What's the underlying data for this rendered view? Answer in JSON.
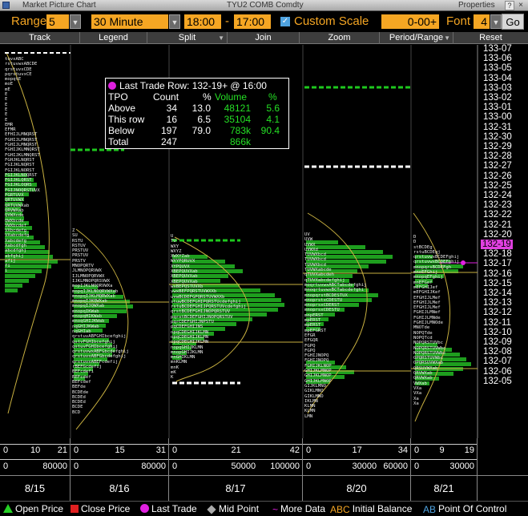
{
  "window": {
    "title": "Market Picture Chart",
    "security": "TYU2 COMB Comdty",
    "properties_label": "Properties",
    "help_label": "?",
    "close_label": "×"
  },
  "controls": {
    "range_label": "Range",
    "range_value": "5",
    "interval_value": "30 Minute",
    "start_time": "18:00",
    "dash": "-",
    "end_time": "17:00",
    "custom_scale_label": "Custom Scale",
    "custom_scale_checked": true,
    "scale_value": "0-00+",
    "font_label": "Font",
    "font_value": "4",
    "go_label": "Go"
  },
  "toolbar": [
    "Track",
    "Legend",
    "Split",
    "Join",
    "Zoom",
    "Period/Range",
    "Reset"
  ],
  "price_axis": [
    "133-07",
    "133-06",
    "133-05",
    "133-04",
    "133-03",
    "133-02",
    "133-01",
    "133-00",
    "132-31",
    "132-30",
    "132-29",
    "132-28",
    "132-27",
    "132-26",
    "132-25",
    "132-24",
    "132-23",
    "132-22",
    "132-21",
    "132-20",
    "132-19",
    "132-18",
    "132-17",
    "132-16",
    "132-15",
    "132-14",
    "132-13",
    "132-12",
    "132-11",
    "132-10",
    "132-09",
    "132-08",
    "132-07",
    "132-06",
    "132-05"
  ],
  "last_trade_price_index": 20,
  "info_box": {
    "header": "Last Trade Row:  132-19+ @  16:00",
    "columns": [
      "TPO",
      "Count",
      "%",
      "Volume",
      "%"
    ],
    "rows": [
      {
        "label": "Above",
        "count": "34",
        "pct": "13.0",
        "volume": "48121",
        "vpct": "5.6"
      },
      {
        "label": "This row",
        "count": "16",
        "pct": "6.5",
        "volume": "35104",
        "vpct": "4.1"
      },
      {
        "label": "Below",
        "count": "197",
        "pct": "79.0",
        "volume": "783k",
        "vpct": "90.4"
      },
      {
        "label": "Total",
        "count": "247",
        "pct": "",
        "volume": "866k",
        "vpct": ""
      }
    ]
  },
  "sessions": [
    {
      "date": "8/15",
      "tpo_scale": [
        "0",
        "10",
        "21"
      ],
      "vol_scale": [
        "0",
        "80000"
      ]
    },
    {
      "date": "8/16",
      "tpo_scale": [
        "0",
        "15",
        "31"
      ],
      "vol_scale": [
        "0",
        "80000"
      ]
    },
    {
      "date": "8/17",
      "tpo_scale": [
        "0",
        "21",
        "42"
      ],
      "vol_scale": [
        "0",
        "50000",
        "100000"
      ]
    },
    {
      "date": "8/20",
      "tpo_scale": [
        "0",
        "17",
        "34"
      ],
      "vol_scale": [
        "0",
        "30000",
        "60000"
      ]
    },
    {
      "date": "8/21",
      "tpo_scale": [
        "0",
        "9",
        "19"
      ],
      "vol_scale": [
        "0",
        "30000"
      ]
    }
  ],
  "tpo_letters": {
    "s1": "tuvxABC\nrstuvwxABCDE\nqrstuvxCDE\npqrstuvxCE\nmopqtE\nmoE\nmE\nE\nE\nE\nE\nE\nE\nEMR\nEFMR\nEFHIJLMNQRST\nFGHIJLMNQRST\nFGHIJLMNQRST\nFGHIJKLMNQRST\nFGHIJKLMNQRST\nFGHJKLNQRST\nFGIJKLNQRST\nFGIJKLNORST\nFGIJKLNOQRST\nFGIJKLQRST\nFGIJKLOQRS\nFGIJNOQRSTUVX\nFGRTUVX\nQRTUVWX\nQRTUVWXab\nQRVWXab\nQVWXcde\nQWXbcde\nVWXbcdef\nVXbcdefg\nVXabcdefg\nXabcdefg\nXabcdfgh\nabcdfghj\nabfghij\nafij\nfi\ni",
    "s2": "Z\nSU\nRSTU\nRSTUV\nPRSTUV\nPRSTUV\nPRSTV\nMNOPQRTV\nJLMNOPQRVWX\nIJLMNOPQRVWX\nIJKLMNOPQRSVWX\nmopIJKLNOQRVWXa\nmopqIJKLNOQRVWXab\nmnopqIJKLMQRWXab\nmnopqIJKQWXab\nmnopqIJQWXab\nmnopqIKWab\nmnopqHIKWab\nmnoqGHIJKWab\nnqGHIJKWab\nnqGHIab\nqrstuvABFGHIbcefghij\nqstvFGHIbcefghij\nqstuvFGHIbcefghij\nqrstuvwxABFGbcdefghij\nqrstuvxABFGbcdefghij\nqrstuvxABEFcdefij\nrBEFGcdefij\nBEFcdefi\nBEFcdef\nBEFcdef\nBEFde\nBCDEde\nBCDEd\nBCDEd\nBCDE\nBCD",
    "s3": "U\nTU\nWXY\nWXYZ\nXWXYZab\nWXYPQRUVX\nXYPQUVX\nXBEPQUVXab\nXBEPQUVXab\nXBEPQUVXab\nwxBEPQSTUVXb\nvwxBEFPQRSTUVWXXb\nuvwBCDEFGPQRSTUVWXXb\nstuwBCDEFGHIPQRSTUcdefghij\nrstuBCDEFGHIJPQRSTUVcdefghij\nqrstBCDEFGHIJNOPQRSTUV\npqrstBCDEFGHIJNOPQRSTUV\npqrCDEFGHIJNPSTU\npqCDEFGHIJNS\nopqCDEGHIJKLMN\nopqCDEGHIJKLMN\nopqCDEGHIJKLMN\nnopqGHIJKLMN\nmnopGHIJKLMN\nmnGHIKLMN\nmnKLMN\nmnK\nmK\nK",
    "s4": "UV\nUVW\nUVWX\nUVWXd\nTUVWXbcd\nTUVWXbcd\nTUVWXbcd\nTUVWXabcde\nqTUVXabcdeh\nqTUVXabcdefghij\nmoqrtuvwxABCTabcdefghij\nmnoqrtuvwxBCTabcdefghi\nmnopqrstBCDESTUX\nmnoprstxCDESTU\nmnoprsxCDERST\nmnoprsxCDESTU\nmnpERST\nmpERST\nmpERST\nmpEFGRST\nEFGR\nEFGQR\nFGPQ\nFGPQ\nFGHIJNOPQ\nFGHIJNOPQ\nFGHIJKLNOP\nGHIJKLMNOP\nGHIJKLMNOP\nGHIJKLMNOP\nGIJKLMNO\nGIKLMNO\nGIKLMNO\nIKLMN\nKLMN\nKLMN\nLMN",
    "s5": "D\nD\nstBCDEg\nrstuBCDEgj\nqrstuvwxBCDEFghij\nqrstuvwxBCDEFghij\nmnopqrsBCDEFgh\nmnoEFGhij\nmnopqEFghij\nmnEFGef\nmEFGHIJef\nmEFGHIJKef\nEFGHIJLMef\nEFGHIJLMef\nEFGHIJLMef\nFGHIJLMNef\nFGHIJLMNde\nFGHIJLMNOde\nMNOTde\nNOPQTde\nNOPQTcd\nNOPQRSTUVbc\nNOPQRSTUVWbc\nNOPQRSTUVWbc\nOPQRSTUVWbc\nOPQRSUVWXab\nQRSUVWXab\nQRVWXab\nQRVWXab\nVWXab\nVXa\nVXa\nXa\nXa"
  },
  "legend": [
    {
      "name": "open-price",
      "label": "Open Price",
      "symbol": "triangle",
      "color": "#25d025"
    },
    {
      "name": "close-price",
      "label": "Close Price",
      "symbol": "square",
      "color": "#e02020"
    },
    {
      "name": "last-trade",
      "label": "Last Trade",
      "symbol": "dot",
      "color": "#e020e0"
    },
    {
      "name": "mid-point",
      "label": "Mid Point",
      "symbol": "diamond",
      "color": "#aaaaaa"
    },
    {
      "name": "more-data",
      "label": "More Data",
      "symbol": "~",
      "color": "#e020e0"
    },
    {
      "name": "initial-balance",
      "label": "Initial Balance",
      "symbol": "ABC",
      "color": "#f5a623"
    },
    {
      "name": "point-of-control",
      "label": "Point Of Control",
      "symbol": "AB",
      "color": "#4fa3e0"
    }
  ],
  "colors": {
    "accent_orange": "#f5a623",
    "volume_green": "#1e9e1e",
    "background": "#000000",
    "last_trade_magenta": "#e020e0"
  }
}
